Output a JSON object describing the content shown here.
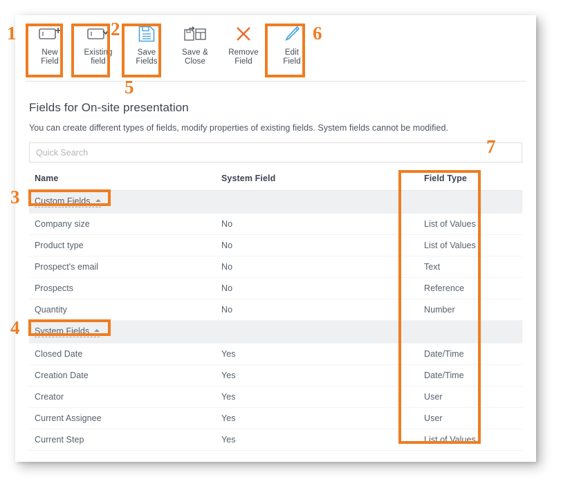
{
  "window": {
    "title": "Fields for On-site presentation"
  },
  "toolbar": {
    "buttons": [
      {
        "id": "new-field",
        "label": "New\nField",
        "icon": "field-plus-icon"
      },
      {
        "id": "existing-field",
        "label": "Existing\nfield",
        "icon": "field-check-icon"
      },
      {
        "id": "save-fields",
        "label": "Save\nFields",
        "icon": "save-disk-icon"
      },
      {
        "id": "save-close",
        "label": "Save &\nClose",
        "icon": "save-and-close-icon"
      },
      {
        "id": "remove-field",
        "label": "Remove\nField",
        "icon": "close-x-icon"
      },
      {
        "id": "edit-field",
        "label": "Edit\nField",
        "icon": "pencil-icon"
      }
    ]
  },
  "page": {
    "title": "Fields for On-site presentation",
    "subtitle": "You can create different types of fields, modify properties of existing fields. System fields cannot be modified."
  },
  "search": {
    "value": "",
    "placeholder": "Quick Search"
  },
  "table": {
    "columns": [
      "Name",
      "System Field",
      "Field Type"
    ],
    "groups": [
      {
        "label": "Custom Fields",
        "expanded": true,
        "rows": [
          {
            "name": "Company size",
            "system": "No",
            "type": "List of Values"
          },
          {
            "name": "Product type",
            "system": "No",
            "type": "List of Values"
          },
          {
            "name": "Prospect's email",
            "system": "No",
            "type": "Text"
          },
          {
            "name": "Prospects",
            "system": "No",
            "type": "Reference"
          },
          {
            "name": "Quantity",
            "system": "No",
            "type": "Number"
          }
        ]
      },
      {
        "label": "System Fields",
        "expanded": true,
        "rows": [
          {
            "name": "Closed Date",
            "system": "Yes",
            "type": "Date/Time"
          },
          {
            "name": "Creation Date",
            "system": "Yes",
            "type": "Date/Time"
          },
          {
            "name": "Creator",
            "system": "Yes",
            "type": "User"
          },
          {
            "name": "Current Assignee",
            "system": "Yes",
            "type": "User"
          },
          {
            "name": "Current Step",
            "system": "Yes",
            "type": "List of Values"
          }
        ]
      }
    ]
  },
  "annotations": {
    "accent_color": "#ee7d22",
    "numbers": [
      {
        "label": "1",
        "target": "new-field-button"
      },
      {
        "label": "2",
        "target": "save-fields-button"
      },
      {
        "label": "3",
        "target": "custom-fields-group"
      },
      {
        "label": "4",
        "target": "system-fields-group"
      },
      {
        "label": "5",
        "target": "existing-field-button"
      },
      {
        "label": "6",
        "target": "edit-field-button"
      },
      {
        "label": "7",
        "target": "field-type-column"
      }
    ]
  }
}
